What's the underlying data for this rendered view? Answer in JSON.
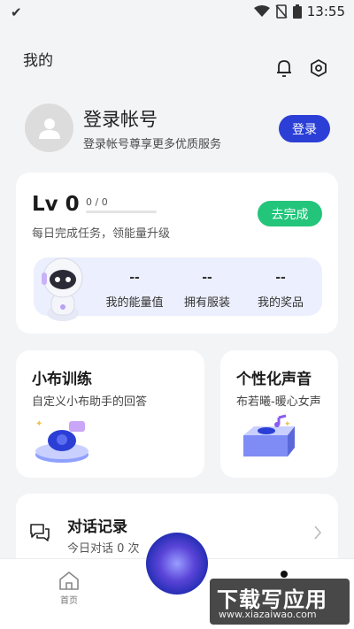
{
  "status_bar": {
    "time": "13:55"
  },
  "header": {
    "title": "我的"
  },
  "login": {
    "title": "登录帐号",
    "subtitle": "登录帐号尊享更多优质服务",
    "button": "登录"
  },
  "level": {
    "label": "Lv 0",
    "progress_text": "0 / 0",
    "progress_fraction": 0,
    "subtitle": "每日完成任务，领能量升级",
    "action": "去完成",
    "stats": [
      {
        "value": "--",
        "label": "我的能量值"
      },
      {
        "value": "--",
        "label": "拥有服装"
      },
      {
        "value": "--",
        "label": "我的奖品"
      }
    ]
  },
  "training": {
    "title": "小布训练",
    "subtitle": "自定义小布助手的回答"
  },
  "voice": {
    "title": "个性化声音",
    "subtitle": "布若曦-暖心女声"
  },
  "history": {
    "title": "对话记录",
    "subtitle": "今日对话 0 次"
  },
  "bottom_nav": {
    "home_label": "首页"
  },
  "watermark": {
    "main": "下载写应用",
    "url": "www.xiazaiwao.com"
  },
  "colors": {
    "primary": "#2b3fd6",
    "success": "#23c57a",
    "panel": "#eceffd"
  }
}
